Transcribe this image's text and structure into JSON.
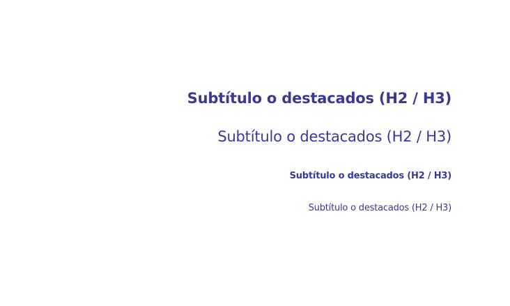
{
  "headings": [
    {
      "text": "Subtítulo o destacados (H2 / H3)",
      "style": "large-bold"
    },
    {
      "text": "Subtítulo o destacados (H2 / H3)",
      "style": "large-regular"
    },
    {
      "text": "Subtítulo o destacados (H2 / H3)",
      "style": "small-bold"
    },
    {
      "text": "Subtítulo o destacados (H2 / H3)",
      "style": "small-regular"
    }
  ],
  "colors": {
    "text": "#3b3898",
    "background": "#ffffff"
  }
}
